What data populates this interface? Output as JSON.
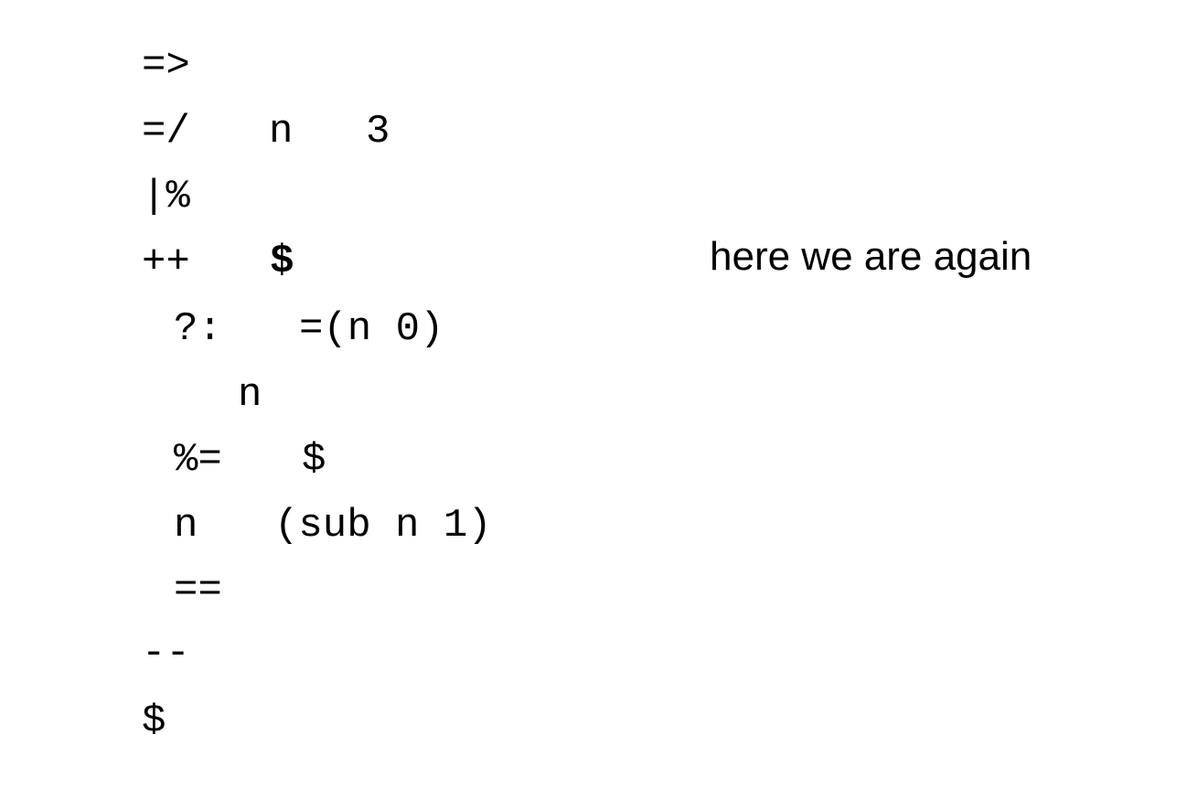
{
  "code_lines": {
    "l1_a": "=>",
    "l2_a": "=/",
    "l2_b": "n",
    "l2_c": "3",
    "l3_a": "|%",
    "l4_a": "++",
    "l4_b": "$",
    "l5_a": "?:",
    "l5_b": "=(n 0)",
    "l6_a": "n",
    "l7_a": "%=",
    "l7_b": "$",
    "l8_a": "n",
    "l8_b": "(sub n 1)",
    "l9_a": "==",
    "l10_a": "--",
    "l11_a": "$"
  },
  "annotation": "here we are again"
}
